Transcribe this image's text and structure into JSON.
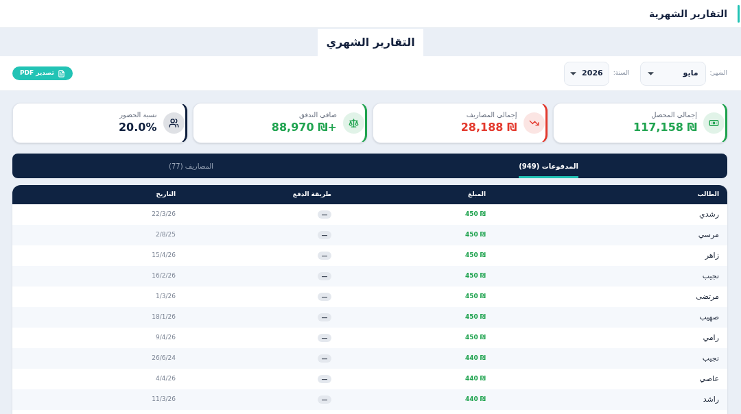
{
  "header": {
    "title": "التقارير الشهرية"
  },
  "page_tab": {
    "title": "التقارير الشهري"
  },
  "filters": [
    {
      "label": "الشهر:",
      "value": "مايو"
    },
    {
      "label": "السنة:",
      "value": "2026"
    }
  ],
  "export_button": {
    "label": "تصدير PDF"
  },
  "stats": [
    {
      "kind": "collected",
      "label": "إجمالي المحصل",
      "value": "117,158 ₪",
      "color": "#1fa34f"
    },
    {
      "kind": "expenses",
      "label": "إجمالي المصاريف",
      "value": "28,188 ₪",
      "color": "#e3392d"
    },
    {
      "kind": "net",
      "label": "صافي التدفق",
      "value": "88,970 ₪+",
      "color": "#1fa34f"
    },
    {
      "kind": "attendance",
      "label": "نسبة الحضور",
      "value": "20.0%",
      "color": "#0f1f3d"
    }
  ],
  "tabs": [
    {
      "label": "المدفوعات (949)",
      "selected": true
    },
    {
      "label": "المصاريف (77)",
      "selected": false
    }
  ],
  "table": {
    "columns": [
      "الطالب",
      "المبلغ",
      "طريقة الدفع",
      "التاريخ"
    ],
    "rows": [
      {
        "student": "رشدي",
        "amount": "450 ₪",
        "method": "—",
        "date": "22/3/26"
      },
      {
        "student": "مرسي",
        "amount": "450 ₪",
        "method": "—",
        "date": "2/8/25"
      },
      {
        "student": "زاهر",
        "amount": "450 ₪",
        "method": "—",
        "date": "15/4/26"
      },
      {
        "student": "نجيب",
        "amount": "450 ₪",
        "method": "—",
        "date": "16/2/26"
      },
      {
        "student": "مرتضى",
        "amount": "450 ₪",
        "method": "—",
        "date": "1/3/26"
      },
      {
        "student": "صهيب",
        "amount": "450 ₪",
        "method": "—",
        "date": "18/1/26"
      },
      {
        "student": "رامي",
        "amount": "450 ₪",
        "method": "—",
        "date": "9/4/26"
      },
      {
        "student": "نجيب",
        "amount": "440 ₪",
        "method": "—",
        "date": "26/6/24"
      },
      {
        "student": "عاصي",
        "amount": "440 ₪",
        "method": "—",
        "date": "4/4/26"
      },
      {
        "student": "راشد",
        "amount": "440 ₪",
        "method": "—",
        "date": "11/3/26"
      }
    ]
  }
}
